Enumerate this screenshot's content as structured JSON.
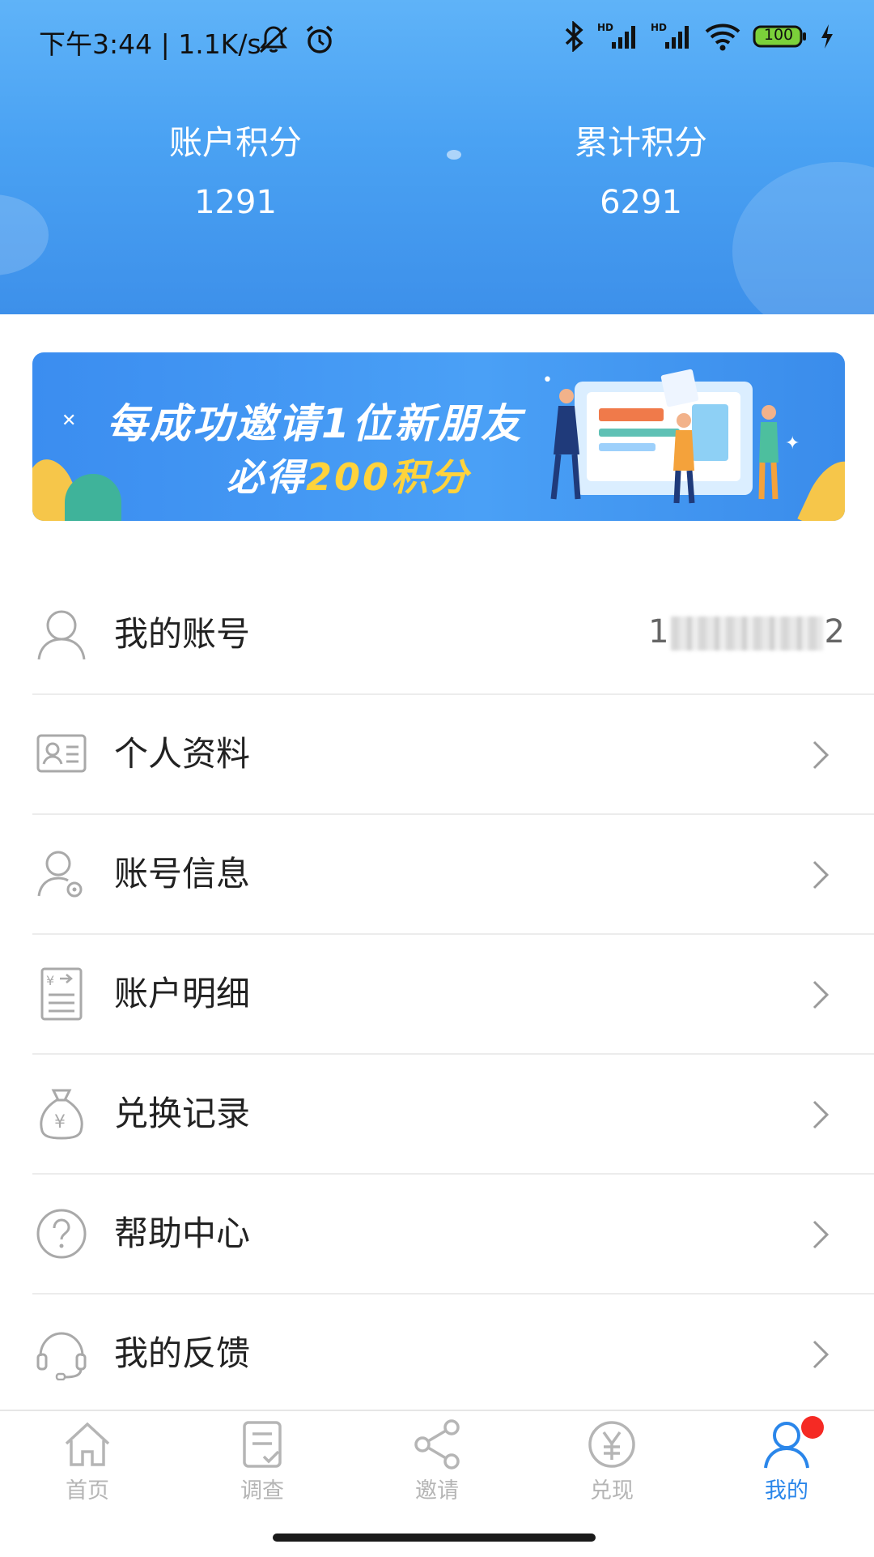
{
  "status_bar": {
    "time": "下午3:44 | 1.1K/s",
    "battery": "100"
  },
  "header": {
    "account_points_label": "账户积分",
    "account_points_value": "1291",
    "total_points_label": "累计积分",
    "total_points_value": "6291"
  },
  "banner": {
    "line1": "每成功邀请1位新朋友",
    "line2_prefix": "必得",
    "line2_highlight": "200积分"
  },
  "menu": {
    "items": [
      {
        "label": "我的账号",
        "value_start": "1",
        "value_end": "2",
        "icon": "user-outline-icon"
      },
      {
        "label": "个人资料",
        "icon": "id-card-icon"
      },
      {
        "label": "账号信息",
        "icon": "user-settings-icon"
      },
      {
        "label": "账户明细",
        "icon": "ledger-icon"
      },
      {
        "label": "兑换记录",
        "icon": "money-bag-icon"
      },
      {
        "label": "帮助中心",
        "icon": "help-circle-icon"
      },
      {
        "label": "我的反馈",
        "icon": "headset-icon"
      }
    ]
  },
  "nav": {
    "items": [
      {
        "label": "首页",
        "icon": "home-icon"
      },
      {
        "label": "调查",
        "icon": "survey-icon"
      },
      {
        "label": "邀请",
        "icon": "share-icon"
      },
      {
        "label": "兑现",
        "icon": "yuan-coin-icon"
      },
      {
        "label": "我的",
        "icon": "profile-icon",
        "active": true
      }
    ]
  },
  "colors": {
    "header_top": "#5fb3f8",
    "header_bottom": "#3d90ea",
    "accent": "#2a86ea",
    "badge": "#f52a24",
    "banner_highlight": "#ffd33c"
  }
}
